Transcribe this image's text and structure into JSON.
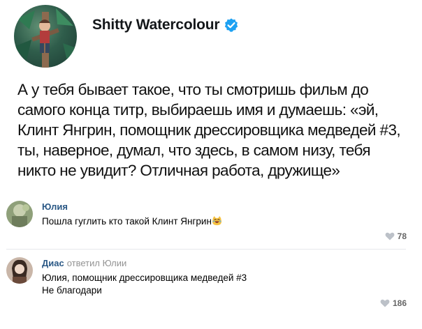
{
  "tweet": {
    "author": "Shitty Watercolour",
    "verified_icon": "verified-badge-icon",
    "text": "А у тебя бывает такое, что ты смотришь фильм до\nсамого конца титр, выбираешь имя и думаешь: «эй,\nКлинт Янгрин, помощник дрессировщика медведей #3,\nты, наверное, думал, что здесь, в самом низу, тебя\nникто не увидит? Отличная работа, дружище»"
  },
  "comments": [
    {
      "name": "Юлия",
      "replied_to": "",
      "text": "Пошла гуглить кто такой Клинт Янгрин",
      "emoji": "laughing-cat-face",
      "likes": "78"
    },
    {
      "name": "Диас",
      "replied_to": "ответил Юлии",
      "text": "Юлия, помощник дрессировщика медведей #3\nНе благодари",
      "likes": "186"
    }
  ],
  "colors": {
    "link": "#2a5885",
    "verified": "#1da1f2",
    "meta": "#939393"
  }
}
